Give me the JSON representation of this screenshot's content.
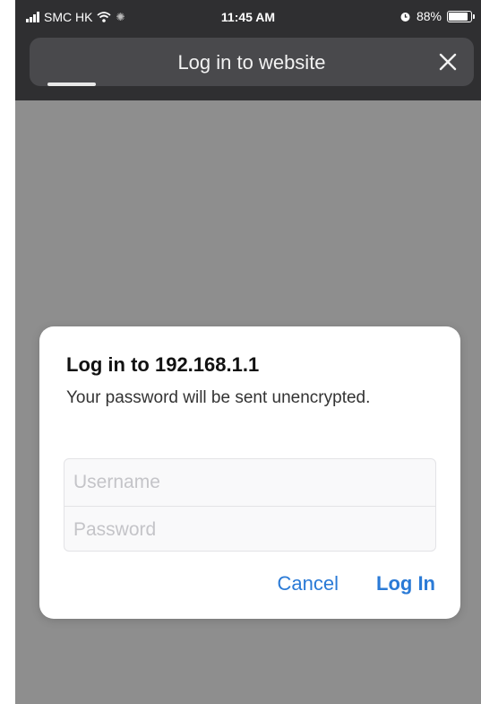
{
  "status_bar": {
    "carrier": "SMC HK",
    "time": "11:45 AM",
    "battery_percent": "88%",
    "battery_level": 0.88
  },
  "sheet": {
    "title": "Log in to website"
  },
  "dialog": {
    "title": "Log in to 192.168.1.1",
    "message": "Your password will be sent unencrypted.",
    "username_placeholder": "Username",
    "password_placeholder": "Password",
    "cancel_label": "Cancel",
    "login_label": "Log In"
  },
  "colors": {
    "accent": "#2a7ad6",
    "overlay": "#8e8e8e",
    "header": "#2f2f31"
  }
}
